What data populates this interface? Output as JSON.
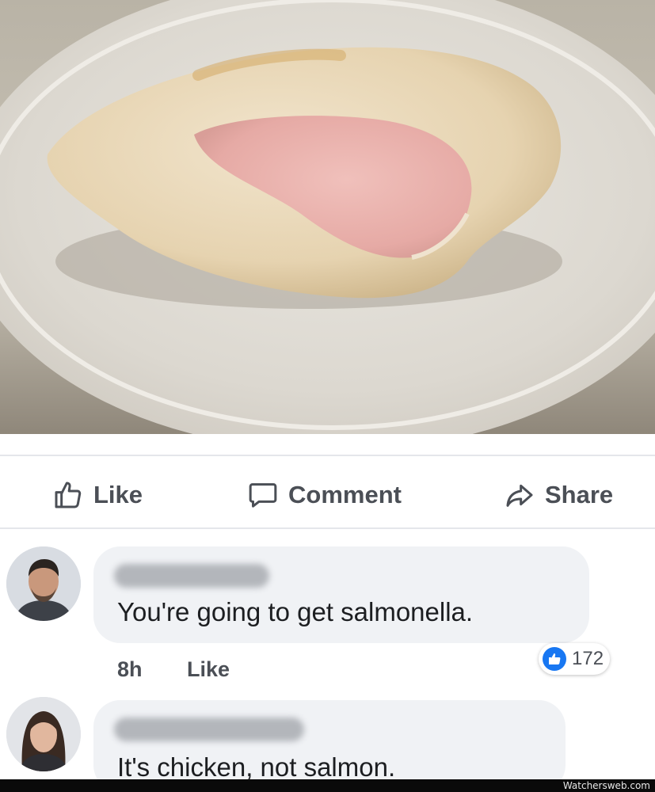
{
  "post": {
    "photo": "chicken-breast-on-plate",
    "actions": {
      "like_label": "Like",
      "comment_label": "Comment",
      "share_label": "Share"
    }
  },
  "comments": [
    {
      "text": "You're going to get salmonella.",
      "time": "8h",
      "like_label": "Like",
      "reaction_count": "172"
    },
    {
      "text": "It's chicken, not salmon."
    }
  ],
  "footer": {
    "watermark": "Watchersweb.com"
  },
  "colors": {
    "reaction_blue": "#1877f2",
    "bubble": "#f0f2f5",
    "action_text": "#4b4f56"
  }
}
